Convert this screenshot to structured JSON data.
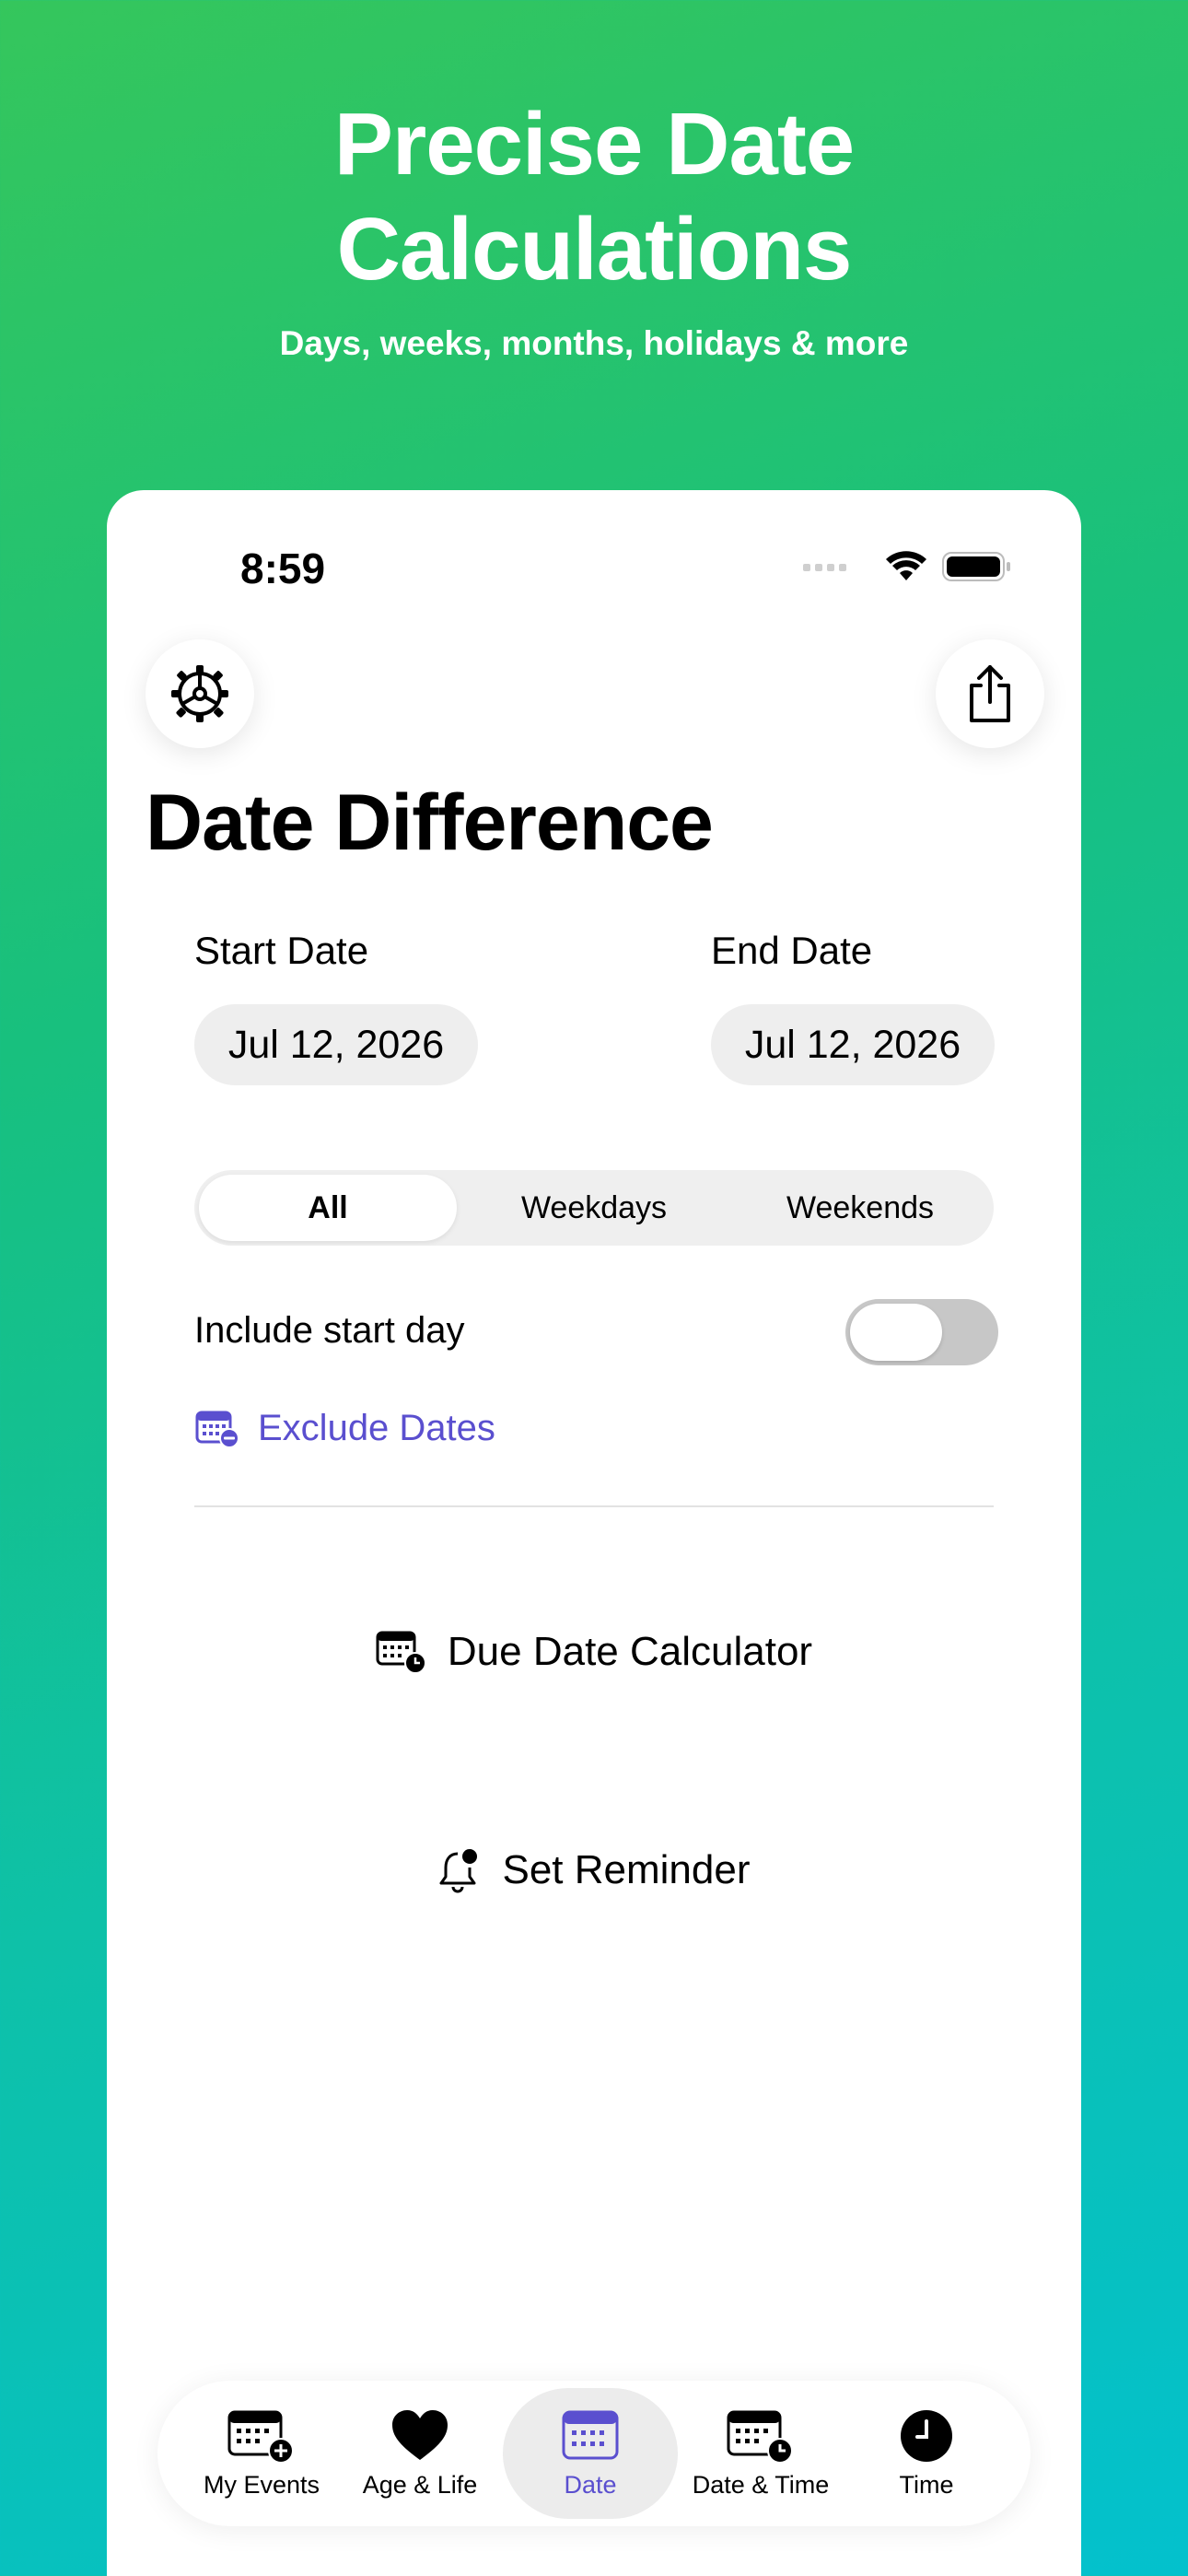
{
  "hero": {
    "title_line1": "Precise Date",
    "title_line2": "Calculations",
    "subtitle": "Days, weeks, months, holidays & more"
  },
  "status_bar": {
    "time": "8:59"
  },
  "toolbar": {
    "settings_icon": "gear-icon",
    "share_icon": "share-icon"
  },
  "screen": {
    "title": "Date Difference"
  },
  "dates": {
    "start_label": "Start Date",
    "start_value": "Jul 12, 2026",
    "end_label": "End Date",
    "end_value": "Jul 12, 2026"
  },
  "segmented": {
    "options": [
      "All",
      "Weekdays",
      "Weekends"
    ],
    "selected": "All"
  },
  "include_start": {
    "label": "Include start day",
    "enabled": false
  },
  "exclude": {
    "label": "Exclude Dates"
  },
  "actions": {
    "due_date": "Due Date Calculator",
    "reminder": "Set Reminder"
  },
  "tabs": [
    {
      "label": "My Events",
      "icon": "calendar-plus-icon"
    },
    {
      "label": "Age & Life",
      "icon": "heart-icon"
    },
    {
      "label": "Date",
      "icon": "calendar-icon"
    },
    {
      "label": "Date & Time",
      "icon": "calendar-clock-icon"
    },
    {
      "label": "Time",
      "icon": "clock-icon"
    }
  ],
  "active_tab": "Date",
  "colors": {
    "accent": "#5a4fcf",
    "gradient_start": "#35c65c",
    "gradient_end": "#03c1cd"
  }
}
